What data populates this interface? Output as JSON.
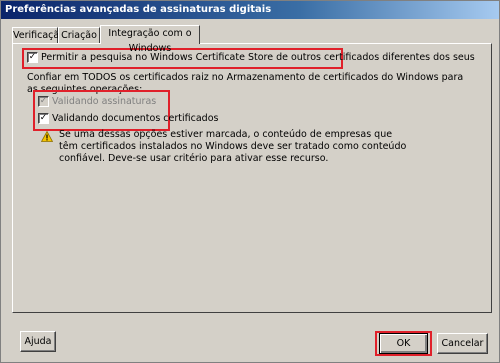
{
  "window": {
    "title": "Preferências avançadas de assinaturas digitais"
  },
  "tabs": [
    {
      "label": "Verificação",
      "active": false
    },
    {
      "label": "Criação",
      "active": false
    },
    {
      "label": "Integração com o Windows",
      "active": true
    }
  ],
  "options": {
    "allow_search": {
      "label": "Permitir a pesquisa no Windows Certificate Store de outros certificados diferentes dos seus",
      "checked": true
    },
    "trust_intro": "Confiar em TODOS os certificados raiz no Armazenamento de certificados do Windows para as seguintes operações:",
    "validate_signatures": {
      "label": "Validando assinaturas",
      "checked": true,
      "enabled": false
    },
    "validate_certified": {
      "label": "Validando documentos certificados",
      "checked": true,
      "enabled": true
    },
    "warning": "Se uma dessas opções estiver marcada, o conteúdo de empresas que têm certificados instalados no Windows deve ser tratado como conteúdo confiável. Deve-se usar critério para ativar esse recurso."
  },
  "buttons": {
    "help": "Ajuda",
    "ok": "OK",
    "cancel": "Cancelar"
  },
  "colors": {
    "highlight": "#e0202a",
    "titlebar": "#0a246a",
    "face": "#d4d0c8"
  },
  "icons": {
    "warning": "warning-icon",
    "check": "check-icon"
  }
}
